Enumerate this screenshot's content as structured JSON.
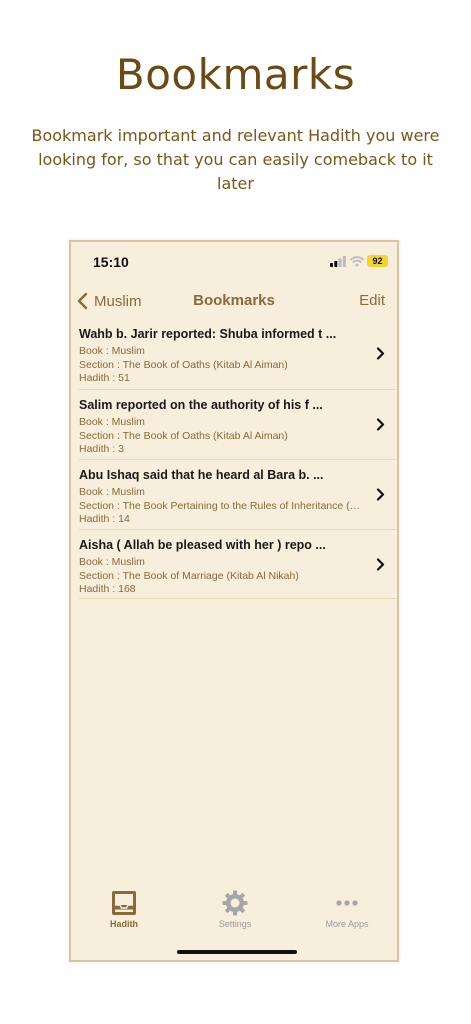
{
  "promo": {
    "title": "Bookmarks",
    "subtitle": "Bookmark important and relevant Hadith you were looking for, so that you can easily comeback to it later"
  },
  "status_bar": {
    "time": "15:10",
    "battery": "92"
  },
  "nav": {
    "back_label": "Muslim",
    "title": "Bookmarks",
    "edit_label": "Edit"
  },
  "bookmarks": [
    {
      "title": "Wahb b. Jarir reported: Shuba informed t ...",
      "book": "Book : Muslim",
      "section": "Section : The Book of Oaths (Kitab Al Aiman)",
      "hadith": "Hadith : 51"
    },
    {
      "title": "Salim reported on the authority of his f ...",
      "book": "Book : Muslim",
      "section": "Section : The Book of Oaths (Kitab Al Aiman)",
      "hadith": "Hadith : 3"
    },
    {
      "title": "Abu Ishaq said that he heard al Bara b.  ...",
      "book": "Book : Muslim",
      "section": "Section : The Book Pertaining to the Rules of Inheritance (Kitab Al Faraid)",
      "hadith": "Hadith : 14"
    },
    {
      "title": "Aisha ( Allah be pleased with her ) repo ...",
      "book": "Book : Muslim",
      "section": "Section : The Book of Marriage (Kitab Al Nikah)",
      "hadith": "Hadith : 168"
    }
  ],
  "tabs": [
    {
      "label": "Hadith",
      "icon": "book-tray-icon",
      "active": true
    },
    {
      "label": "Settings",
      "icon": "gear-icon",
      "active": false
    },
    {
      "label": "More Apps",
      "icon": "more-dots-icon",
      "active": false
    }
  ],
  "colors": {
    "accent": "#8a6a3c",
    "background": "#f7eedb",
    "promo_text": "#6b4a14"
  }
}
